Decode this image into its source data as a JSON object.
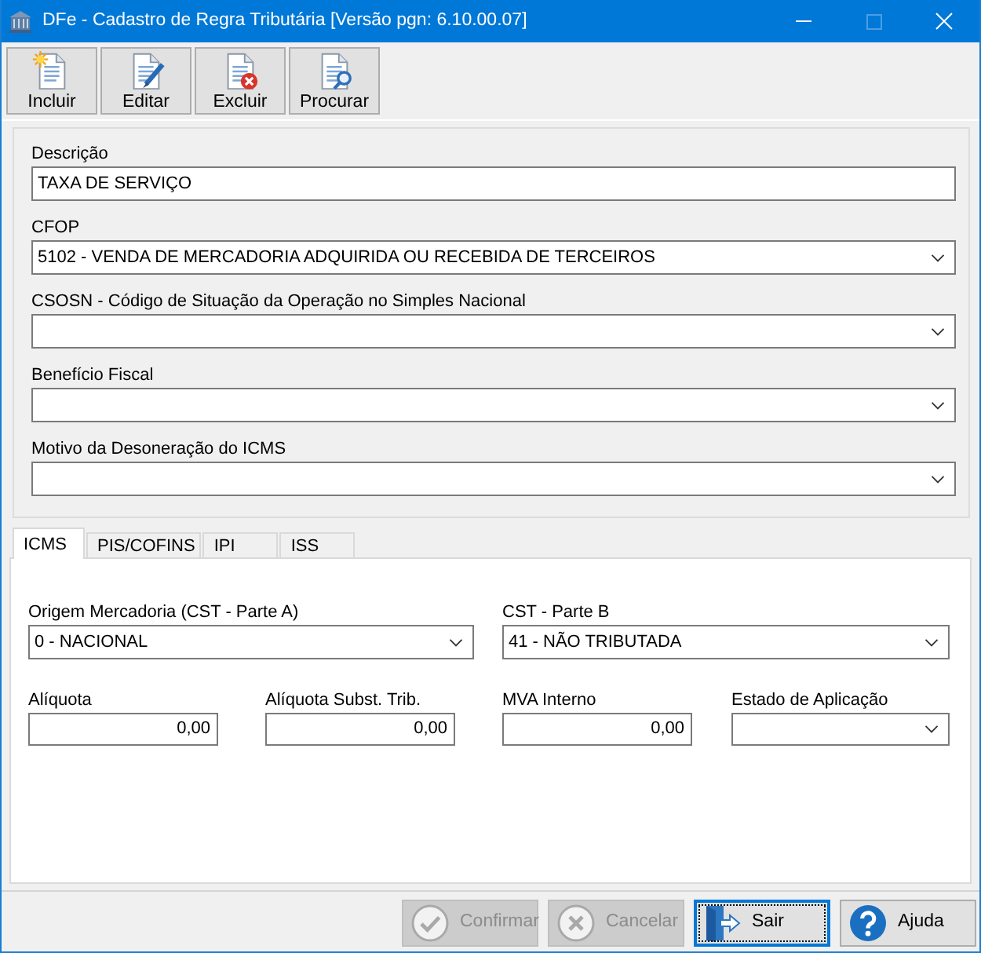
{
  "window": {
    "title": "DFe - Cadastro de Regra Tributária [Versão pgn: 6.10.00.07]",
    "maximize_disabled": true
  },
  "toolbar": [
    {
      "kind": "new",
      "label": "Incluir"
    },
    {
      "kind": "edit",
      "label": "Editar"
    },
    {
      "kind": "delete",
      "label": "Excluir"
    },
    {
      "kind": "search",
      "label": "Procurar"
    }
  ],
  "form": [
    {
      "kind": "text",
      "label": "Descrição",
      "value": "TAXA DE SERVIÇO"
    },
    {
      "kind": "select",
      "label": "CFOP",
      "value": "5102 - VENDA DE MERCADORIA ADQUIRIDA OU RECEBIDA DE TERCEIROS"
    },
    {
      "kind": "select",
      "label": "CSOSN - Código de Situação da Operação no Simples Nacional"
    },
    {
      "kind": "select",
      "label": "Benefício Fiscal"
    },
    {
      "kind": "select",
      "label": "Motivo da Desoneração do ICMS"
    }
  ],
  "tabs": [
    {
      "label": "ICMS",
      "selected": true
    },
    {
      "label": "PIS/COFINS",
      "selected": false
    },
    {
      "label": "IPI",
      "selected": false
    },
    {
      "label": "ISS",
      "selected": false
    }
  ],
  "tab_panel": {
    "row_1": [
      {
        "kind": "select",
        "label": "Origem Mercadoria (CST - Parte A)",
        "value": "0 - NACIONAL"
      },
      {
        "kind": "select",
        "label": "CST - Parte B",
        "value": "41 - NÃO TRIBUTADA"
      }
    ],
    "row_2": [
      {
        "kind": "number",
        "label": "Alíquota",
        "value": "0,00"
      },
      {
        "kind": "number",
        "label": "Alíquota Subst. Trib.",
        "value": "0,00"
      },
      {
        "kind": "number",
        "label": "MVA Interno",
        "value": "0,00"
      },
      {
        "kind": "select",
        "label": "Estado de Aplicação"
      }
    ]
  },
  "buttons": [
    {
      "kind": "confirm",
      "label": "Confirmar",
      "disabled": true,
      "focused": false
    },
    {
      "kind": "cancel",
      "label": "Cancelar",
      "disabled": true,
      "focused": false
    },
    {
      "kind": "exit",
      "label": "Sair",
      "disabled": false,
      "focused": true
    },
    {
      "kind": "help",
      "label": "Ajuda",
      "disabled": false,
      "focused": false
    }
  ]
}
